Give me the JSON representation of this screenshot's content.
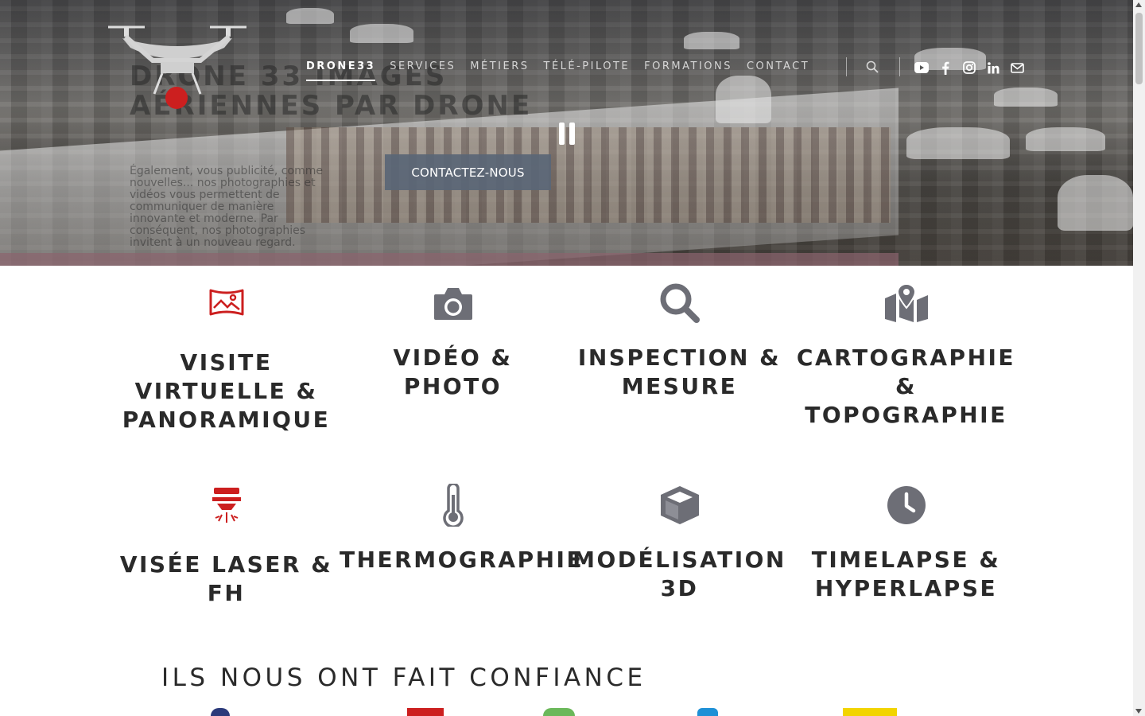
{
  "brand": {
    "name": "DRONE33",
    "accent": "#cc1f1f",
    "icon_gray": "#6d6e76"
  },
  "hero": {
    "title": "Drone 33 Images aériennes par drone",
    "text": "Également, vous publicité, comme nouvelles... nos photographies et vidéos vous permettent de communiquer de manière innovante et moderne. Par conséquent, nos photographies invitent à un nouveau regard.",
    "cta_label": "CONTACTEZ-NOUS"
  },
  "nav": {
    "items": [
      {
        "label": "DRONE33",
        "active": true
      },
      {
        "label": "SERVICES"
      },
      {
        "label": "MÉTIERS"
      },
      {
        "label": "TÉLÉ-PILOTE"
      },
      {
        "label": "FORMATIONS"
      },
      {
        "label": "CONTACT"
      }
    ],
    "search_icon": "search-icon",
    "social": [
      "youtube-icon",
      "facebook-icon",
      "instagram-icon",
      "linkedin-icon",
      "envelope-icon"
    ]
  },
  "services": [
    {
      "title": "VISITE VIRTUELLE & PANORAMIQUE",
      "icon": "panorama-icon",
      "color": "#cc1f1f"
    },
    {
      "title": "VIDÉO & PHOTO",
      "icon": "camera-icon",
      "color": "#6d6e76"
    },
    {
      "title": "INSPECTION & MESURE",
      "icon": "magnifier-icon",
      "color": "#6d6e76"
    },
    {
      "title": "CARTOGRAPHIE & TOPOGRAPHIE",
      "icon": "map-marker-icon",
      "color": "#6d6e76"
    },
    {
      "title": "VISÉE LASER & FH",
      "icon": "laser-icon",
      "color": "#cc1f1f"
    },
    {
      "title": "THERMOGRAPHIE",
      "icon": "thermometer-icon",
      "color": "#6d6e76"
    },
    {
      "title": "MODÉLISATION 3D",
      "icon": "cube-icon",
      "color": "#6d6e76"
    },
    {
      "title": "TIMELAPSE & HYPERLAPSE",
      "icon": "clock-icon",
      "color": "#6d6e76"
    }
  ],
  "trust": {
    "title": "ILS NOUS ONT FAIT CONFIANCE"
  }
}
